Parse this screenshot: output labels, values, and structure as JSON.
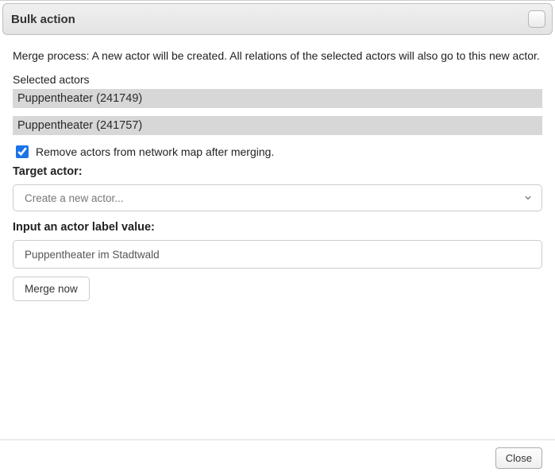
{
  "titlebar": {
    "title": "Bulk action"
  },
  "description": "Merge process: A new actor will be created. All relations of the selected actors will also go to this new actor.",
  "selected_actors_label": "Selected actors",
  "selected_actors": [
    "Puppentheater (241749)",
    "Puppentheater (241757)"
  ],
  "remove_checkbox": {
    "checked": true,
    "label": "Remove actors from network map after merging."
  },
  "target_actor_label": "Target actor:",
  "target_actor_select": {
    "placeholder": "Create a new actor..."
  },
  "actor_label_field_label": "Input an actor label value:",
  "actor_label_value": "Puppentheater im Stadtwald",
  "merge_button_label": "Merge now",
  "footer": {
    "close_label": "Close"
  }
}
